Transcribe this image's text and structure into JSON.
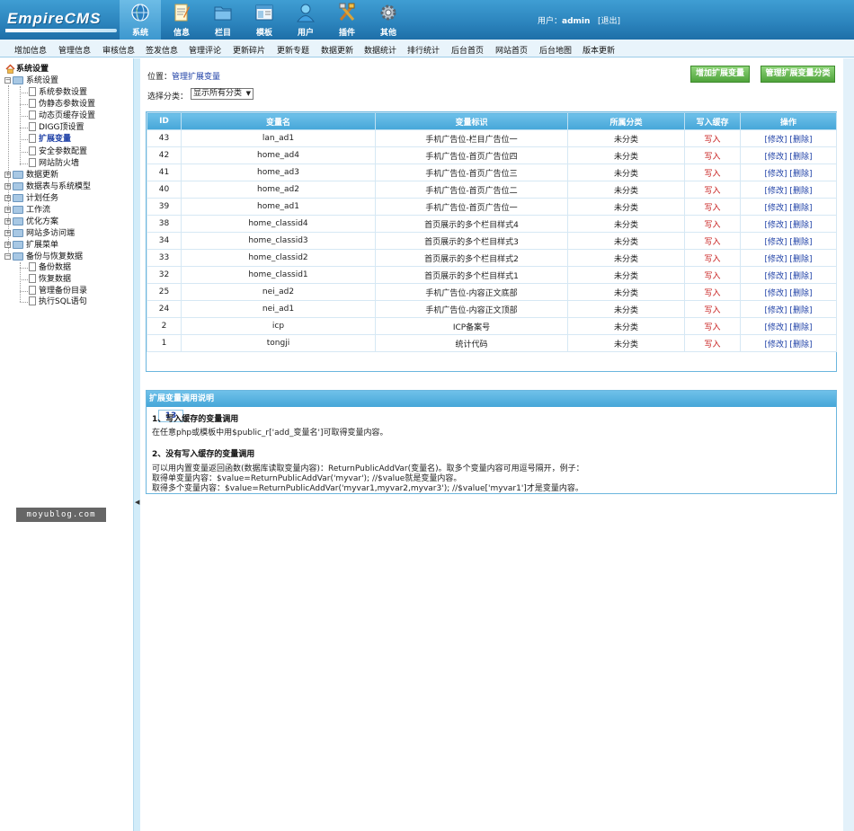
{
  "header": {
    "logo": "EmpireCMS",
    "tabs": [
      {
        "label": "系统",
        "icon": "globe-icon"
      },
      {
        "label": "信息",
        "icon": "notepad-icon"
      },
      {
        "label": "栏目",
        "icon": "folder-icon"
      },
      {
        "label": "模板",
        "icon": "template-icon"
      },
      {
        "label": "用户",
        "icon": "user-icon"
      },
      {
        "label": "插件",
        "icon": "tools-icon"
      },
      {
        "label": "其他",
        "icon": "gear-icon"
      }
    ],
    "user_label": "用户：",
    "user_name": "admin",
    "logout": "[退出]"
  },
  "submenu": [
    "增加信息",
    "管理信息",
    "审核信息",
    "签发信息",
    "管理评论",
    "更新碎片",
    "更新专题",
    "数据更新",
    "数据统计",
    "排行统计",
    "后台首页",
    "网站首页",
    "后台地图",
    "版本更新"
  ],
  "sidebar": {
    "root": "系统设置",
    "group1": {
      "label": "系统设置",
      "items": [
        "系统参数设置",
        "伪静态参数设置",
        "动态页缓存设置",
        "DIGG顶设置",
        "扩展变量",
        "安全参数配置",
        "网站防火墙"
      ]
    },
    "groups": [
      "数据更新",
      "数据表与系统模型",
      "计划任务",
      "工作流",
      "优化方案",
      "网站多访问端",
      "扩展菜单"
    ],
    "group_last": {
      "label": "备份与恢复数据",
      "items": [
        "备份数据",
        "恢复数据",
        "管理备份目录",
        "执行SQL语句"
      ]
    },
    "watermark": "moyublog.com"
  },
  "main": {
    "location_label": "位置：",
    "location_link": "管理扩展变量",
    "btn_add": "增加扩展变量",
    "btn_manage": "管理扩展变量分类",
    "filter_label": "选择分类：",
    "filter_value": "显示所有分类",
    "table": {
      "headers": [
        "ID",
        "变量名",
        "变量标识",
        "所属分类",
        "写入缓存",
        "操作"
      ],
      "rows": [
        [
          "43",
          "lan_ad1",
          "手机广告位-栏目广告位一",
          "未分类",
          "写入",
          "[修改] [删除]"
        ],
        [
          "42",
          "home_ad4",
          "手机广告位-首页广告位四",
          "未分类",
          "写入",
          "[修改] [删除]"
        ],
        [
          "41",
          "home_ad3",
          "手机广告位-首页广告位三",
          "未分类",
          "写入",
          "[修改] [删除]"
        ],
        [
          "40",
          "home_ad2",
          "手机广告位-首页广告位二",
          "未分类",
          "写入",
          "[修改] [删除]"
        ],
        [
          "39",
          "home_ad1",
          "手机广告位-首页广告位一",
          "未分类",
          "写入",
          "[修改] [删除]"
        ],
        [
          "38",
          "home_classid4",
          "首页展示的多个栏目样式4",
          "未分类",
          "写入",
          "[修改] [删除]"
        ],
        [
          "34",
          "home_classid3",
          "首页展示的多个栏目样式3",
          "未分类",
          "写入",
          "[修改] [删除]"
        ],
        [
          "33",
          "home_classid2",
          "首页展示的多个栏目样式2",
          "未分类",
          "写入",
          "[修改] [删除]"
        ],
        [
          "32",
          "home_classid1",
          "首页展示的多个栏目样式1",
          "未分类",
          "写入",
          "[修改] [删除]"
        ],
        [
          "25",
          "nei_ad2",
          "手机广告位-内容正文底部",
          "未分类",
          "写入",
          "[修改] [删除]"
        ],
        [
          "24",
          "nei_ad1",
          "手机广告位-内容正文顶部",
          "未分类",
          "写入",
          "[修改] [删除]"
        ],
        [
          "2",
          "icp",
          "ICP备案号",
          "未分类",
          "写入",
          "[修改] [删除]"
        ],
        [
          "1",
          "tongji",
          "统计代码",
          "未分类",
          "写入",
          "[修改] [删除]"
        ]
      ]
    },
    "pager": "13",
    "help": {
      "title": "扩展变量调用说明",
      "h1": "1、写入缓存的变量调用",
      "p1": "在任意php或模板中用$public_r['add_变量名']可取得变量内容。",
      "h2": "2、没有写入缓存的变量调用",
      "p2a": "可以用内置变量返回函数(数据库读取变量内容)：ReturnPublicAddVar(变量名)。取多个变量内容可用逗号隔开，例子：",
      "p2b": "取得单变量内容：$value=ReturnPublicAddVar('myvar'); //$value就是变量内容。",
      "p2c": "取得多个变量内容：$value=ReturnPublicAddVar('myvar1,myvar2,myvar3'); //$value['myvar1']才是变量内容。"
    }
  }
}
